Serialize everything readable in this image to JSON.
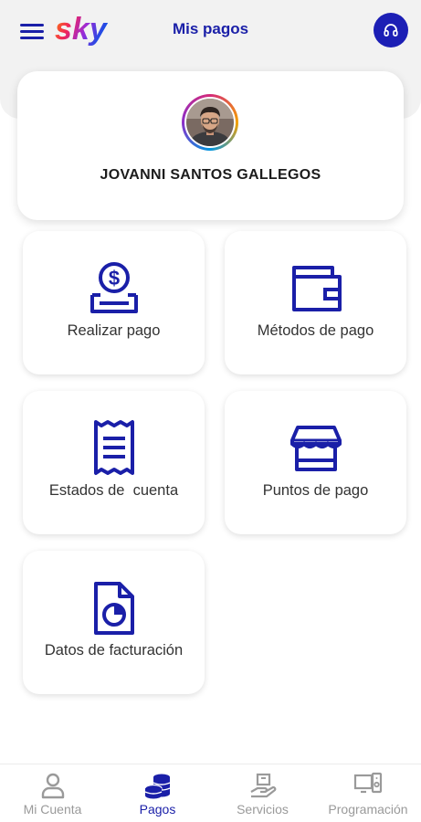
{
  "header": {
    "title": "Mis pagos",
    "brand": "sky",
    "menu_icon": "hamburger-menu-icon",
    "help_icon": "headset-icon"
  },
  "profile": {
    "name": "JOVANNI SANTOS GALLEGOS"
  },
  "tiles": [
    {
      "label": "Realizar pago",
      "icon": "money-hand-icon"
    },
    {
      "label": "Métodos de pago",
      "icon": "wallet-icon"
    },
    {
      "label": "Estados de  cuenta",
      "icon": "receipt-icon"
    },
    {
      "label": "Puntos de pago",
      "icon": "storefront-icon"
    },
    {
      "label": "Datos de facturación",
      "icon": "invoice-chart-icon"
    }
  ],
  "bottom_nav": [
    {
      "label": "Mi Cuenta",
      "icon": "user-icon",
      "active": false
    },
    {
      "label": "Pagos",
      "icon": "coins-icon",
      "active": true
    },
    {
      "label": "Servicios",
      "icon": "service-box-icon",
      "active": false
    },
    {
      "label": "Programación",
      "icon": "devices-icon",
      "active": false
    }
  ],
  "colors": {
    "primary": "#1A1FA8",
    "help_button": "#1C1FB5",
    "inactive_nav": "#9A9A9A",
    "header_background": "#F2F2F2"
  }
}
